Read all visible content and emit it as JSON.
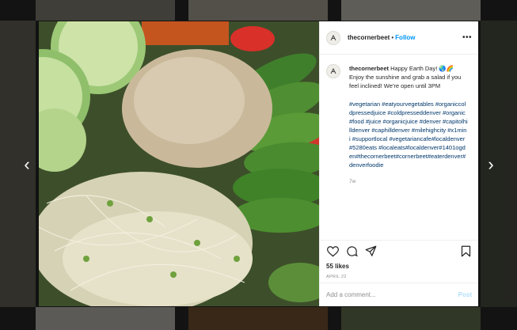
{
  "navigation": {
    "prev_icon": "chevron-left-icon",
    "prev_glyph": "‹",
    "next_icon": "chevron-right-icon",
    "next_glyph": "›"
  },
  "post": {
    "username": "thecornerbeet",
    "header_separator": "•",
    "follow_label": "Follow",
    "more_glyph": "•••",
    "caption": {
      "username": "thecornerbeet",
      "text": "Happy Earth Day! 🌏🌈 Enjoy the sunshine and grab a salad if you feel inclined! We're open until 3PM",
      "hashtags": "#vegetarian #eatyourvegetables #organiccoldpressedjuice #coldpresseddenver #organic #food #juice #organicjuice #denver #capitolhilldenver #caphilldenver #milehighcity #x1mini #supportlocal #vegetariancafe#localdenver#5280eats #localeats#localdenver#1401ogden#thecornerbeet#cornerbeet#eaterdenver#denverfoodie",
      "age": "7w"
    },
    "likes": "55 likes",
    "date": "APRIL 22",
    "comment_placeholder": "Add a comment...",
    "post_label": "Post"
  },
  "colors": {
    "link": "#0095f6",
    "hashtag": "#00376b",
    "post_disabled": "#b2dffc"
  },
  "icons": [
    "heart-icon",
    "comment-icon",
    "share-icon",
    "bookmark-icon",
    "avatar-icon"
  ]
}
